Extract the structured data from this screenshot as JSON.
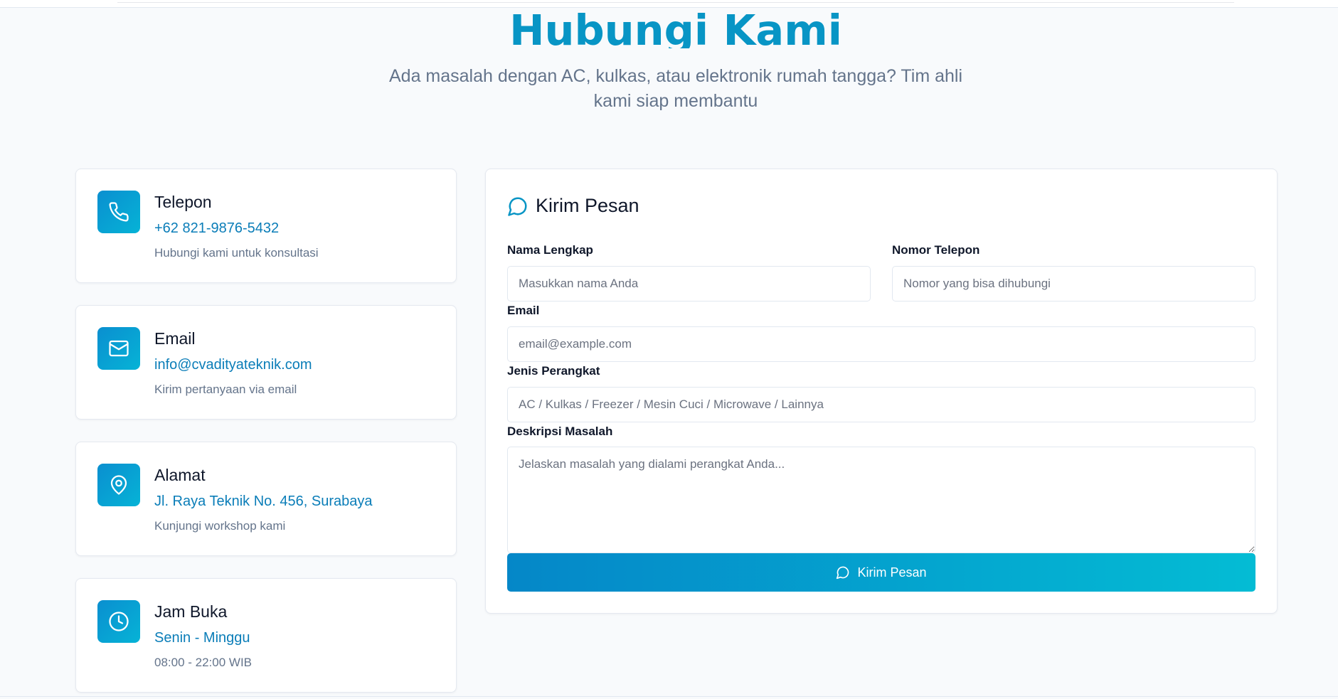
{
  "header": {
    "title": "Hubungi Kami",
    "subtitle": "Ada masalah dengan AC, kulkas, atau elektronik rumah tangga? Tim ahli kami siap membantu"
  },
  "contact_cards": [
    {
      "icon": "phone-icon",
      "title": "Telepon",
      "value": "+62 821-9876-5432",
      "desc": "Hubungi kami untuk konsultasi"
    },
    {
      "icon": "mail-icon",
      "title": "Email",
      "value": "info@cvadityateknik.com",
      "desc": "Kirim pertanyaan via email"
    },
    {
      "icon": "map-pin-icon",
      "title": "Alamat",
      "value": "Jl. Raya Teknik No. 456, Surabaya",
      "desc": "Kunjungi workshop kami"
    },
    {
      "icon": "clock-icon",
      "title": "Jam Buka",
      "value": "Senin - Minggu",
      "desc": "08:00 - 22:00 WIB"
    }
  ],
  "form": {
    "title": "Kirim Pesan",
    "fields": {
      "name": {
        "label": "Nama Lengkap",
        "placeholder": "Masukkan nama Anda",
        "value": ""
      },
      "phone": {
        "label": "Nomor Telepon",
        "placeholder": "Nomor yang bisa dihubungi",
        "value": ""
      },
      "email": {
        "label": "Email",
        "placeholder": "email@example.com",
        "value": ""
      },
      "device": {
        "label": "Jenis Perangkat",
        "placeholder": "AC / Kulkas / Freezer / Mesin Cuci / Microwave / Lainnya",
        "value": ""
      },
      "description": {
        "label": "Deskripsi Masalah",
        "placeholder": "Jelaskan masalah yang dialami perangkat Anda...",
        "value": ""
      }
    },
    "submit_label": "Kirim Pesan"
  },
  "colors": {
    "accent": "#0895c5",
    "link": "#0a7db8",
    "gradient_start": "#0587c8",
    "gradient_end": "#04bcd4",
    "muted_text": "#64748b"
  }
}
